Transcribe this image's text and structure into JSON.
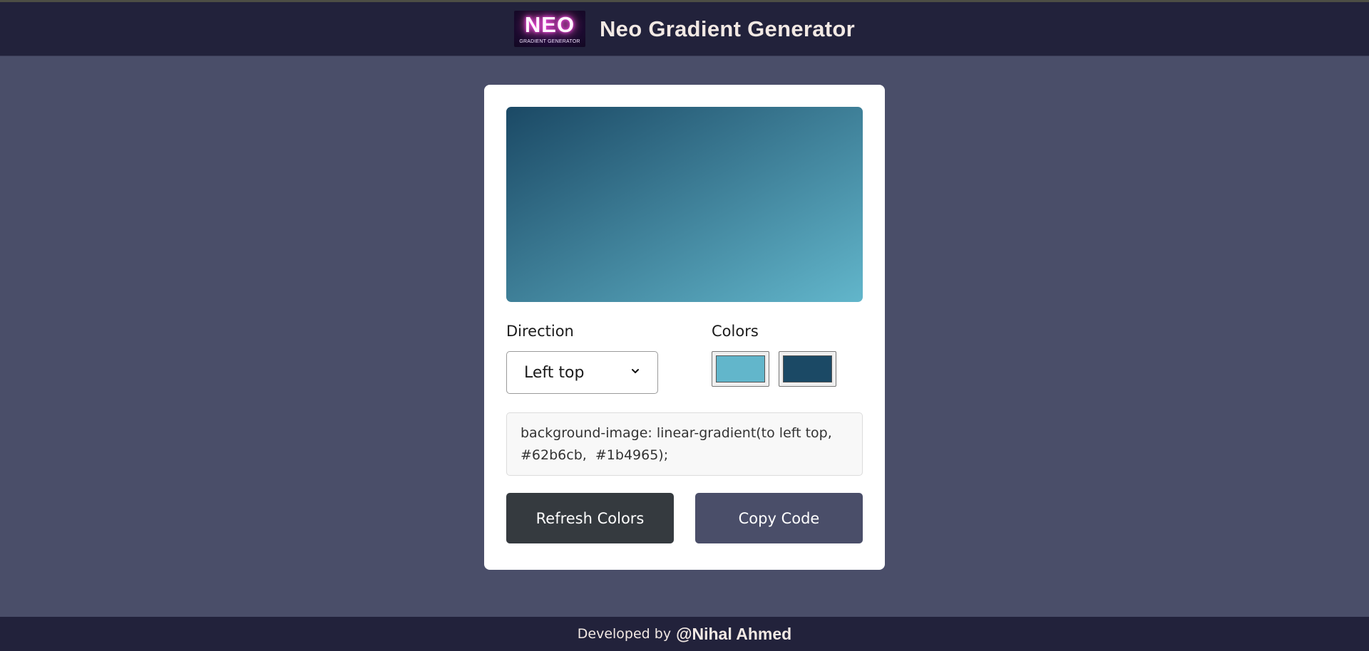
{
  "header": {
    "logo": {
      "word": "NEO",
      "subtitle": "GRADIENT GENERATOR"
    },
    "title": "Neo Gradient Generator"
  },
  "generator": {
    "preview": {
      "direction": "to left top",
      "color_1": "#62b6cb",
      "color_2": "#1b4965"
    },
    "direction_label": "Direction",
    "direction_value": "Left top",
    "colors_label": "Colors",
    "swatches": [
      {
        "color": "#62b6cb"
      },
      {
        "color": "#1b4965"
      }
    ],
    "code": "background-image: linear-gradient(to left top, #62b6cb,  #1b4965);",
    "refresh_button": "Refresh Colors",
    "copy_button": "Copy Code"
  },
  "footer": {
    "prefix": "Developed by",
    "author": "@Nihal Ahmed"
  },
  "theme": {
    "page_bg": "#4a4e69",
    "header_bg": "#22223b",
    "refresh_bg": "#353a3f",
    "copy_bg": "#4a4e69"
  }
}
